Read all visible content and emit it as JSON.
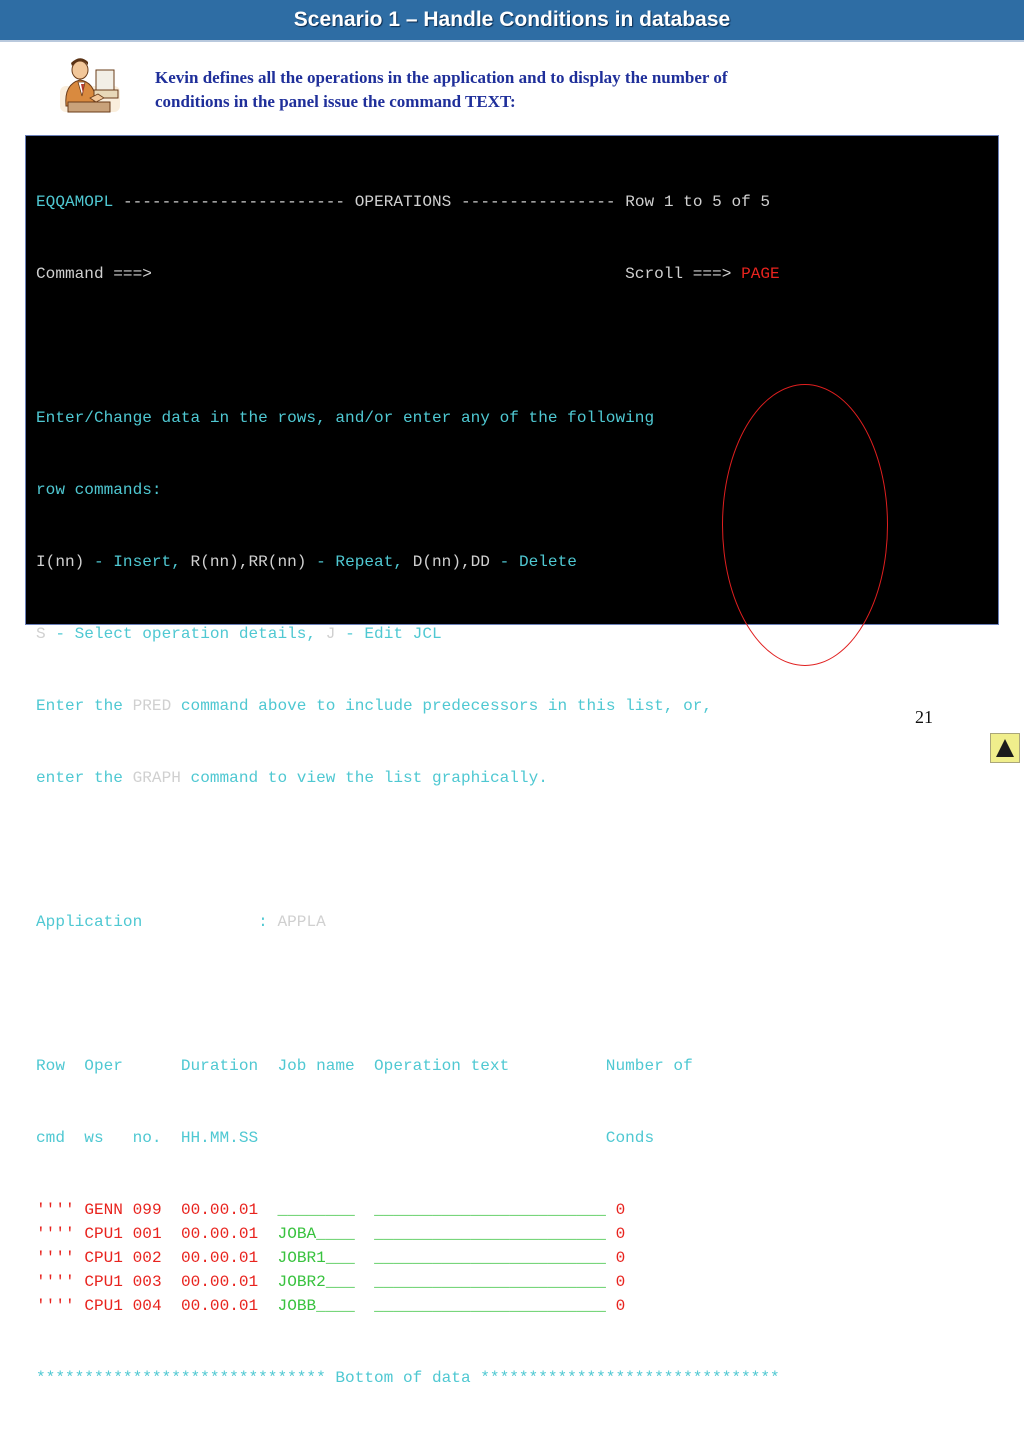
{
  "slide": {
    "title": "Scenario 1 – Handle Conditions in database",
    "intro_line1": "Kevin defines all the operations in the application and to display the number of",
    "intro_line2": "conditions in the panel issue the command TEXT:",
    "page_number": "21",
    "nav_icon": "up-triangle-icon"
  },
  "colors": {
    "title_bar": "#2e6da4",
    "intro_text": "#1f2f9a",
    "terminal_bg": "#000000",
    "teal": "#4fc8d2",
    "white": "#d0d0d0",
    "red": "#e8231e",
    "green": "#38c23e",
    "annotation": "#e01f1f"
  },
  "terminal": {
    "panel_id": "EQQAMOPL",
    "header_dash1": "-----------------------",
    "panel_name": "OPERATIONS",
    "header_dash2": "----------------",
    "row_info": "Row 1 to 5 of 5",
    "command_label": "Command ===>",
    "scroll_label": "Scroll ===>",
    "scroll_value": "PAGE",
    "help1": "Enter/Change data in the rows, and/or enter any of the following",
    "help2": "row commands:",
    "help3": {
      "cmd1": "I(nn)",
      "desc1": " - Insert, ",
      "cmd2": "R(nn),RR(nn)",
      "desc2": " - Repeat, ",
      "cmd3": "D(nn),DD",
      "desc3": " - Delete"
    },
    "help4": {
      "cmd1": "S",
      "desc1": " - Select operation details, ",
      "cmd2": "J",
      "desc2": " - Edit JCL"
    },
    "help5": {
      "pre": "Enter the ",
      "cmd": "PRED",
      "post": " command above to include predecessors in this list, or,"
    },
    "help6": {
      "pre": "enter the ",
      "cmd": "GRAPH",
      "post": " command to view the list graphically."
    },
    "application_label": "Application            :",
    "application_value": "APPLA",
    "col_header1": "Row  Oper      Duration  Job name  Operation text          Number of",
    "col_header2": "cmd  ws   no.  HH.MM.SS                                    Conds",
    "rows": [
      {
        "cmd": "''''",
        "ws": "GENN",
        "no": "099",
        "duration": "00.00.01",
        "jobname": "________",
        "optext": "________________________",
        "conds": "0"
      },
      {
        "cmd": "''''",
        "ws": "CPU1",
        "no": "001",
        "duration": "00.00.01",
        "jobname": "JOBA____",
        "optext": "________________________",
        "conds": "0"
      },
      {
        "cmd": "''''",
        "ws": "CPU1",
        "no": "002",
        "duration": "00.00.01",
        "jobname": "JOBR1___",
        "optext": "________________________",
        "conds": "0"
      },
      {
        "cmd": "''''",
        "ws": "CPU1",
        "no": "003",
        "duration": "00.00.01",
        "jobname": "JOBR2___",
        "optext": "________________________",
        "conds": "0"
      },
      {
        "cmd": "''''",
        "ws": "CPU1",
        "no": "004",
        "duration": "00.00.01",
        "jobname": "JOBB____",
        "optext": "________________________",
        "conds": "0"
      }
    ],
    "bottom_line": "****************************** Bottom of data *******************************"
  }
}
